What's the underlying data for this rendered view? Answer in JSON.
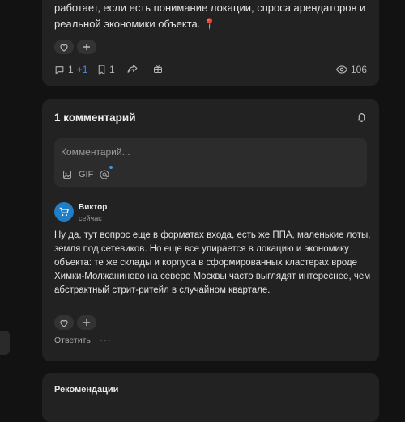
{
  "post": {
    "text": "работает, если есть понимание локации, спроса арендаторов и реальной экономики объекта.",
    "pin_emoji": "📍",
    "stats": {
      "comments": "1",
      "comments_new": "+1",
      "bookmarks": "1",
      "views": "106"
    }
  },
  "comments": {
    "title": "1 комментарий",
    "composer": {
      "placeholder": "Комментарий...",
      "gif_label": "GIF"
    },
    "items": [
      {
        "author": "Виктор",
        "time": "сейчас",
        "text": "Ну да, тут вопрос еще в форматах входа, есть же ППА, маленькие лоты, земля под сетевиков. Но еще все упирается в локацию и экономику объекта: те же склады и корпуса в сформированных кластерах вроде Химки-Молжаниново на севере Москвы часто выглядят интереснее, чем абстрактный стрит-ритейл в случайном квартале.",
        "reply_label": "Ответить",
        "more_label": "···"
      }
    ]
  },
  "recommendations": {
    "title": "Рекомендации"
  },
  "colors": {
    "accent": "#4a90e2",
    "card": "#222222",
    "background": "#121212",
    "avatar": "#1f7ec6"
  }
}
